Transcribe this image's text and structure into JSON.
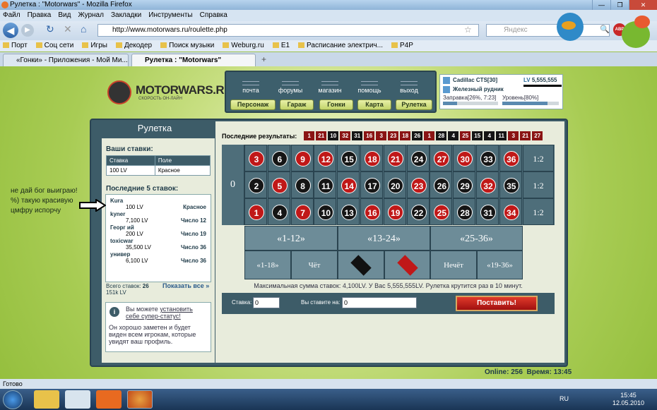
{
  "browser": {
    "title": "Рулетка : \"Motorwars\" - Mozilla Firefox",
    "menu": [
      "Файл",
      "Правка",
      "Вид",
      "Журнал",
      "Закладки",
      "Инструменты",
      "Справка"
    ],
    "url": "http://www.motorwars.ru/roulette.php",
    "search_placeholder": "Яндекс",
    "bookmarks": [
      "Порт",
      "Соц сети",
      "Игры",
      "Декодер",
      "Поиск музыки",
      "Weburg.ru",
      "E1",
      "Расписание электрич...",
      "P4P"
    ],
    "tabs": [
      "«Гонки» - Приложения - Мой Ми...",
      "Рулетка : \"Motorwars\""
    ],
    "status": "Готово"
  },
  "site": {
    "logo_text": "MOTORWARS.RU",
    "logo_sub": "СКОРОСТЬ ОН-ЛАЙН",
    "nav_top": [
      "почта",
      "форумы",
      "магазин",
      "помощь",
      "выход"
    ],
    "nav_buttons": [
      "Персонаж",
      "Гараж",
      "Гонки",
      "Карта",
      "Рулетка"
    ],
    "player": {
      "car": "Cadillac CTS[30]",
      "money": "5,555,555",
      "money_prefix": "LV",
      "location": "Железный рудник",
      "fuel_label": "Заправка[26%, 7:23]",
      "level_label": "Уровень[80%]",
      "fuel_pct": 26,
      "level_pct": 80
    }
  },
  "roulette": {
    "title": "Рулетка",
    "your_bets_title": "Ваши ставки:",
    "bets_headers": [
      "Ставка",
      "Поле"
    ],
    "bets_rows": [
      [
        "100 LV",
        "Красное"
      ]
    ],
    "last5_title": "Последние 5 ставок:",
    "last5": [
      {
        "name": "Kura",
        "amount": "100 LV",
        "field": "Красное"
      },
      {
        "name": "kyner",
        "amount": "7,100 LV",
        "field": "Число 12"
      },
      {
        "name": "Георг ий",
        "amount": "200 LV",
        "field": "Число 19"
      },
      {
        "name": "toxicwar",
        "amount": "35,500 LV",
        "field": "Число 36"
      },
      {
        "name": "универ",
        "amount": "6,100 LV",
        "field": "Число 36"
      }
    ],
    "total_label": "Всего ставок:",
    "total_count": "26",
    "total_sum": "151k LV",
    "show_all": "Показать все »",
    "info_text1": "Вы можете",
    "info_link": "установить себе супер-статус!",
    "info_text2": "Он хорошо заметен и будет виден всем игрокам, которые увидят ваш профиль.",
    "results_label": "Последние результаты:",
    "results": [
      {
        "n": "1",
        "c": "#8a1414"
      },
      {
        "n": "21",
        "c": "#8a1414"
      },
      {
        "n": "10",
        "c": "#151515"
      },
      {
        "n": "32",
        "c": "#8a1414"
      },
      {
        "n": "31",
        "c": "#151515"
      },
      {
        "n": "16",
        "c": "#8a1414"
      },
      {
        "n": "3",
        "c": "#8a1414"
      },
      {
        "n": "23",
        "c": "#8a1414"
      },
      {
        "n": "18",
        "c": "#8a1414"
      },
      {
        "n": "26",
        "c": "#151515"
      },
      {
        "n": "1",
        "c": "#8a1414"
      },
      {
        "n": "28",
        "c": "#151515"
      },
      {
        "n": "4",
        "c": "#151515"
      },
      {
        "n": "25",
        "c": "#8a1414"
      },
      {
        "n": "15",
        "c": "#151515"
      },
      {
        "n": "4",
        "c": "#151515"
      },
      {
        "n": "11",
        "c": "#151515"
      },
      {
        "n": "3",
        "c": "#8a1414"
      },
      {
        "n": "21",
        "c": "#8a1414"
      },
      {
        "n": "27",
        "c": "#8a1414"
      }
    ],
    "zero": "0",
    "rows": [
      [
        {
          "n": "3",
          "c": "red"
        },
        {
          "n": "6",
          "c": "black"
        },
        {
          "n": "9",
          "c": "red"
        },
        {
          "n": "12",
          "c": "red"
        },
        {
          "n": "15",
          "c": "black"
        },
        {
          "n": "18",
          "c": "red"
        },
        {
          "n": "21",
          "c": "red"
        },
        {
          "n": "24",
          "c": "black"
        },
        {
          "n": "27",
          "c": "red"
        },
        {
          "n": "30",
          "c": "red"
        },
        {
          "n": "33",
          "c": "black"
        },
        {
          "n": "36",
          "c": "red"
        }
      ],
      [
        {
          "n": "2",
          "c": "black"
        },
        {
          "n": "5",
          "c": "red"
        },
        {
          "n": "8",
          "c": "black"
        },
        {
          "n": "11",
          "c": "black"
        },
        {
          "n": "14",
          "c": "red"
        },
        {
          "n": "17",
          "c": "black"
        },
        {
          "n": "20",
          "c": "black"
        },
        {
          "n": "23",
          "c": "red"
        },
        {
          "n": "26",
          "c": "black"
        },
        {
          "n": "29",
          "c": "black"
        },
        {
          "n": "32",
          "c": "red"
        },
        {
          "n": "35",
          "c": "black"
        }
      ],
      [
        {
          "n": "1",
          "c": "red"
        },
        {
          "n": "4",
          "c": "black"
        },
        {
          "n": "7",
          "c": "red"
        },
        {
          "n": "10",
          "c": "black"
        },
        {
          "n": "13",
          "c": "black"
        },
        {
          "n": "16",
          "c": "red"
        },
        {
          "n": "19",
          "c": "red"
        },
        {
          "n": "22",
          "c": "black"
        },
        {
          "n": "25",
          "c": "red"
        },
        {
          "n": "28",
          "c": "black"
        },
        {
          "n": "31",
          "c": "black"
        },
        {
          "n": "34",
          "c": "red"
        }
      ]
    ],
    "column_bet": "1:2",
    "dozens": [
      "«1-12»",
      "«13-24»",
      "«25-36»"
    ],
    "evens": [
      "«1-18»",
      "Чёт",
      "",
      "",
      "Нечёт",
      "«19-36»"
    ],
    "max_line": "Максимальная сумма ставок: 4,100LV. У Вас 5,555,555LV. Рулетка крутится раз в 10 минут.",
    "stake_label": "Ставка:",
    "stake_value": "0",
    "you_bet_label": "Вы ставите на:",
    "you_bet_value": "0",
    "place_button": "Поставить!",
    "online_label": "Online:",
    "online_value": "256",
    "time_label": "Время:",
    "time_value": "13:45"
  },
  "annotation": "не дай бог выиграю! %) такую красивую цмфру испорчу",
  "taskbar": {
    "lang": "RU",
    "time": "15:45",
    "date": "12.05.2010"
  }
}
